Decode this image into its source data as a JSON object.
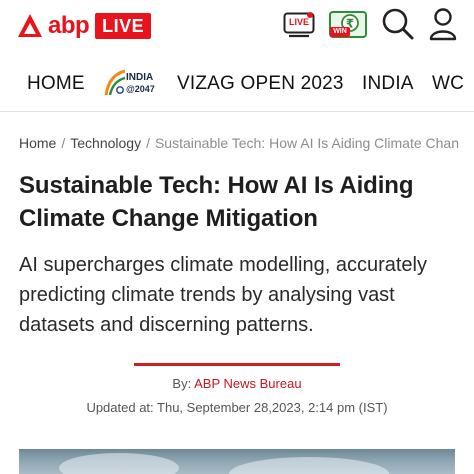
{
  "header": {
    "logo_text": "abp",
    "live_badge": "LIVE",
    "live_icon_label": "LIVE",
    "win_icon_label": "WIN",
    "brand_color": "#e8141c",
    "icons": [
      "live-tv-icon",
      "rupee-win-icon",
      "search-icon",
      "user-icon"
    ]
  },
  "nav": {
    "items": [
      {
        "label": "HOME"
      },
      {
        "label": "INDIA",
        "sub": "@2047"
      },
      {
        "label": "VIZAG OPEN 2023"
      },
      {
        "label": "INDIA"
      },
      {
        "label": "WC"
      }
    ]
  },
  "breadcrumb": {
    "items": [
      "Home",
      "Technology"
    ],
    "current": "Sustainable Tech: How AI Is Aiding Climate Chan",
    "separator": "/"
  },
  "article": {
    "title": "Sustainable Tech: How AI Is Aiding Climate Change Mitigation",
    "subtitle": "AI supercharges climate modelling, accurately predicting climate trends by analysing vast datasets and discerning patterns.",
    "byline_prefix": "By:",
    "author": "ABP News Bureau",
    "updated": "Updated at: Thu, September 28,2023, 2:14 pm (IST)",
    "accent_color": "#cf1f24"
  }
}
